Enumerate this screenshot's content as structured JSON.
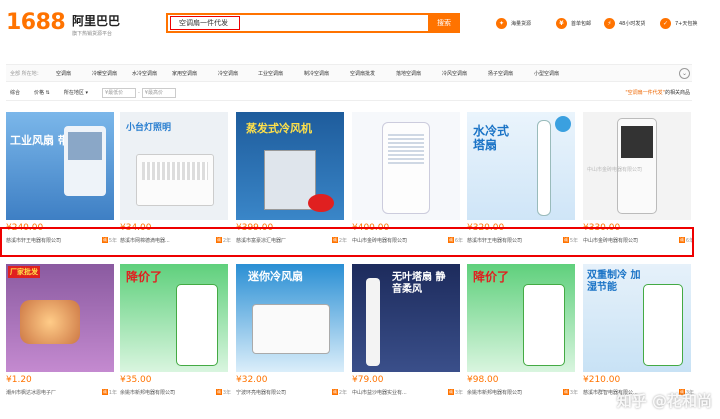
{
  "header": {
    "logo_number": "1688",
    "logo_name": "阿里巴巴",
    "logo_sub": "旗下热销货源平台",
    "search_value": "空调扇一件代发",
    "search_button": "搜索",
    "services": [
      {
        "icon": "hot-icon",
        "label": "海量货源"
      },
      {
        "icon": "cart-icon",
        "label": "首单包邮"
      },
      {
        "icon": "truck-icon",
        "label": "48小时发货"
      },
      {
        "icon": "shield-icon",
        "label": "7+天包换"
      }
    ]
  },
  "category_bar": {
    "label": "全部 所在地：",
    "items": [
      "空调扇",
      "冷暖空调扇",
      "水冷空调扇",
      "家用空调扇",
      "冷空调扇",
      "工业空调扇",
      "制冷空调扇",
      "空调扇批发",
      "落地空调扇",
      "冷风空调扇",
      "扬子空调扇",
      "小型空调扇"
    ]
  },
  "sort_bar": {
    "items": [
      "综合",
      "价格",
      "所在地区"
    ],
    "price_min": "¥最低价",
    "price_max": "¥最高价",
    "result_text_prefix": "\"空调扇一件代发\"",
    "result_text_suffix": "的相关商品"
  },
  "products_row1": [
    {
      "price": "¥240.00",
      "shop": "慈溪市轩王电器有限公司",
      "years": "5年",
      "img_text": "工业风扇 带回家",
      "bg": "#6aa9e0"
    },
    {
      "price": "¥34.00",
      "shop": "慈溪市网棉德滴电器...",
      "years": "2年",
      "img_text": "小台灯照明",
      "bg": "#e9eef3"
    },
    {
      "price": "¥399.00",
      "shop": "慈溪市富豪凉汇电器厂",
      "years": "2年",
      "img_text": "蒸发式冷风机",
      "bg": "#2d6db0"
    },
    {
      "price": "¥400.00",
      "shop": "中山市金砖电器有限公司",
      "years": "6年",
      "img_text": "",
      "bg": "#f5f7fa"
    },
    {
      "price": "¥320.00",
      "shop": "慈溪市轩王电器有限公司",
      "years": "5年",
      "img_text": "水冷式 塔扇",
      "bg": "#e7f2fb"
    },
    {
      "price": "¥330.00",
      "shop": "中山市金砖电器有限公司",
      "years": "6年",
      "img_text": "中山市金砖电器有限公司",
      "bg": "#f2f2f2"
    }
  ],
  "products_row2": [
    {
      "price": "¥1.20",
      "shop": "潮州市枫达冰恩电子厂",
      "years": "1年",
      "img_text": "厂家批发",
      "bg": "#7a4b8e"
    },
    {
      "price": "¥35.00",
      "shop": "余姚市新邦电器有限公司",
      "years": "3年",
      "img_text": "降价了",
      "bg": "#4fc36b"
    },
    {
      "price": "¥32.00",
      "shop": "宁波环亮电器有限公司",
      "years": "2年",
      "img_text": "迷你冷风扇",
      "bg": "#2a8fd4"
    },
    {
      "price": "¥79.00",
      "shop": "中山市益沙电器实业有...",
      "years": "3年",
      "img_text": "无叶塔扇 静音柔风",
      "bg": "#1d2b5c"
    },
    {
      "price": "¥98.00",
      "shop": "余姚市新邦电器有限公司",
      "years": "3年",
      "img_text": "降价了",
      "bg": "#4fc36b"
    },
    {
      "price": "¥210.00",
      "shop": "慈溪市群智电器有限公...",
      "years": "3年",
      "img_text": "双重制冷 加湿节能",
      "bg": "#e6f1fa"
    }
  ],
  "watermark": "知乎 @花和尚",
  "colors": {
    "accent": "#ff7300",
    "highlight_box": "#e00000"
  }
}
